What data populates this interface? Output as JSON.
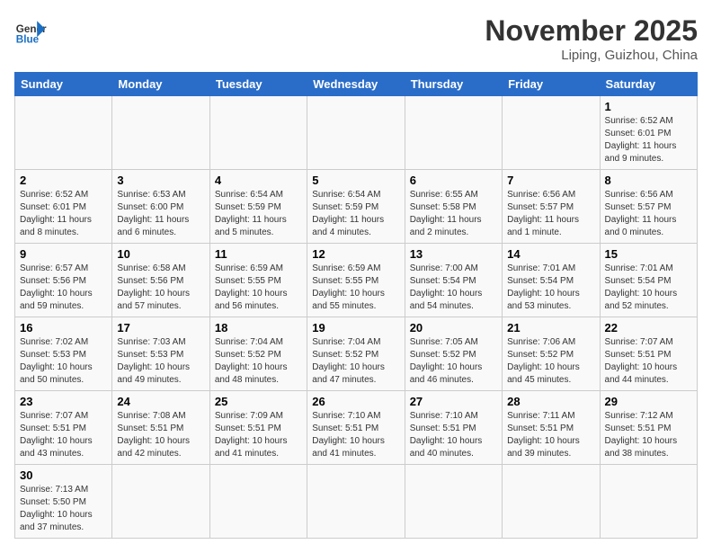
{
  "header": {
    "logo_general": "General",
    "logo_blue": "Blue",
    "month_title": "November 2025",
    "location": "Liping, Guizhou, China"
  },
  "weekdays": [
    "Sunday",
    "Monday",
    "Tuesday",
    "Wednesday",
    "Thursday",
    "Friday",
    "Saturday"
  ],
  "weeks": [
    [
      {
        "day": "",
        "info": ""
      },
      {
        "day": "",
        "info": ""
      },
      {
        "day": "",
        "info": ""
      },
      {
        "day": "",
        "info": ""
      },
      {
        "day": "",
        "info": ""
      },
      {
        "day": "",
        "info": ""
      },
      {
        "day": "1",
        "info": "Sunrise: 6:52 AM\nSunset: 6:01 PM\nDaylight: 11 hours\nand 9 minutes."
      }
    ],
    [
      {
        "day": "2",
        "info": "Sunrise: 6:52 AM\nSunset: 6:01 PM\nDaylight: 11 hours\nand 8 minutes."
      },
      {
        "day": "3",
        "info": "Sunrise: 6:53 AM\nSunset: 6:00 PM\nDaylight: 11 hours\nand 6 minutes."
      },
      {
        "day": "4",
        "info": "Sunrise: 6:54 AM\nSunset: 5:59 PM\nDaylight: 11 hours\nand 5 minutes."
      },
      {
        "day": "5",
        "info": "Sunrise: 6:54 AM\nSunset: 5:59 PM\nDaylight: 11 hours\nand 4 minutes."
      },
      {
        "day": "6",
        "info": "Sunrise: 6:55 AM\nSunset: 5:58 PM\nDaylight: 11 hours\nand 2 minutes."
      },
      {
        "day": "7",
        "info": "Sunrise: 6:56 AM\nSunset: 5:57 PM\nDaylight: 11 hours\nand 1 minute."
      },
      {
        "day": "8",
        "info": "Sunrise: 6:56 AM\nSunset: 5:57 PM\nDaylight: 11 hours\nand 0 minutes."
      }
    ],
    [
      {
        "day": "9",
        "info": "Sunrise: 6:57 AM\nSunset: 5:56 PM\nDaylight: 10 hours\nand 59 minutes."
      },
      {
        "day": "10",
        "info": "Sunrise: 6:58 AM\nSunset: 5:56 PM\nDaylight: 10 hours\nand 57 minutes."
      },
      {
        "day": "11",
        "info": "Sunrise: 6:59 AM\nSunset: 5:55 PM\nDaylight: 10 hours\nand 56 minutes."
      },
      {
        "day": "12",
        "info": "Sunrise: 6:59 AM\nSunset: 5:55 PM\nDaylight: 10 hours\nand 55 minutes."
      },
      {
        "day": "13",
        "info": "Sunrise: 7:00 AM\nSunset: 5:54 PM\nDaylight: 10 hours\nand 54 minutes."
      },
      {
        "day": "14",
        "info": "Sunrise: 7:01 AM\nSunset: 5:54 PM\nDaylight: 10 hours\nand 53 minutes."
      },
      {
        "day": "15",
        "info": "Sunrise: 7:01 AM\nSunset: 5:54 PM\nDaylight: 10 hours\nand 52 minutes."
      }
    ],
    [
      {
        "day": "16",
        "info": "Sunrise: 7:02 AM\nSunset: 5:53 PM\nDaylight: 10 hours\nand 50 minutes."
      },
      {
        "day": "17",
        "info": "Sunrise: 7:03 AM\nSunset: 5:53 PM\nDaylight: 10 hours\nand 49 minutes."
      },
      {
        "day": "18",
        "info": "Sunrise: 7:04 AM\nSunset: 5:52 PM\nDaylight: 10 hours\nand 48 minutes."
      },
      {
        "day": "19",
        "info": "Sunrise: 7:04 AM\nSunset: 5:52 PM\nDaylight: 10 hours\nand 47 minutes."
      },
      {
        "day": "20",
        "info": "Sunrise: 7:05 AM\nSunset: 5:52 PM\nDaylight: 10 hours\nand 46 minutes."
      },
      {
        "day": "21",
        "info": "Sunrise: 7:06 AM\nSunset: 5:52 PM\nDaylight: 10 hours\nand 45 minutes."
      },
      {
        "day": "22",
        "info": "Sunrise: 7:07 AM\nSunset: 5:51 PM\nDaylight: 10 hours\nand 44 minutes."
      }
    ],
    [
      {
        "day": "23",
        "info": "Sunrise: 7:07 AM\nSunset: 5:51 PM\nDaylight: 10 hours\nand 43 minutes."
      },
      {
        "day": "24",
        "info": "Sunrise: 7:08 AM\nSunset: 5:51 PM\nDaylight: 10 hours\nand 42 minutes."
      },
      {
        "day": "25",
        "info": "Sunrise: 7:09 AM\nSunset: 5:51 PM\nDaylight: 10 hours\nand 41 minutes."
      },
      {
        "day": "26",
        "info": "Sunrise: 7:10 AM\nSunset: 5:51 PM\nDaylight: 10 hours\nand 41 minutes."
      },
      {
        "day": "27",
        "info": "Sunrise: 7:10 AM\nSunset: 5:51 PM\nDaylight: 10 hours\nand 40 minutes."
      },
      {
        "day": "28",
        "info": "Sunrise: 7:11 AM\nSunset: 5:51 PM\nDaylight: 10 hours\nand 39 minutes."
      },
      {
        "day": "29",
        "info": "Sunrise: 7:12 AM\nSunset: 5:51 PM\nDaylight: 10 hours\nand 38 minutes."
      }
    ],
    [
      {
        "day": "30",
        "info": "Sunrise: 7:13 AM\nSunset: 5:50 PM\nDaylight: 10 hours\nand 37 minutes."
      },
      {
        "day": "",
        "info": ""
      },
      {
        "day": "",
        "info": ""
      },
      {
        "day": "",
        "info": ""
      },
      {
        "day": "",
        "info": ""
      },
      {
        "day": "",
        "info": ""
      },
      {
        "day": "",
        "info": ""
      }
    ]
  ]
}
